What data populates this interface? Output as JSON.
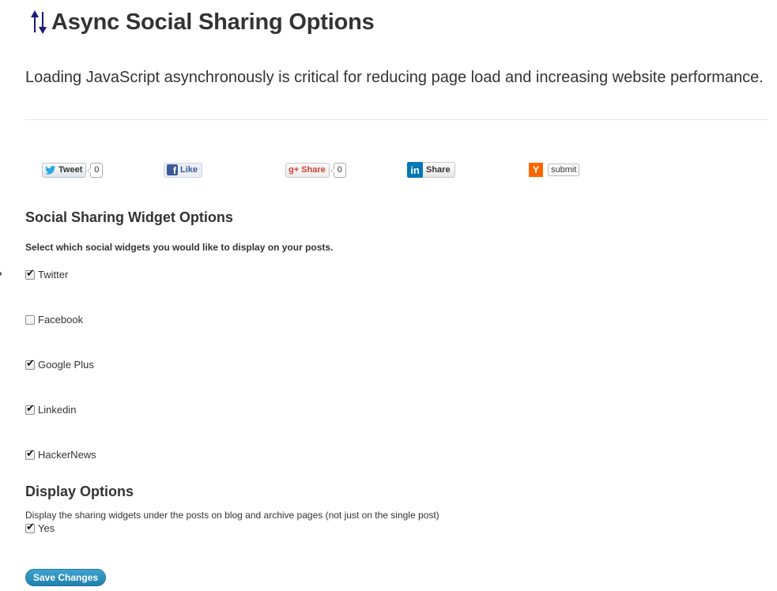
{
  "page": {
    "title": "Async Social Sharing Options",
    "intro": "Loading JavaScript asynchronously is critical for reducing page load and increasing website performance.",
    "icon": "up-down-arrows-icon"
  },
  "preview": {
    "twitter": {
      "label": "Tweet",
      "count": "0",
      "icon": "twitter-bird-icon",
      "color": "#2aa9e0"
    },
    "facebook": {
      "label": "Like",
      "icon": "facebook-f-icon",
      "color": "#3b5998"
    },
    "googleplus": {
      "label": "Share",
      "count": "0",
      "badge": "g+",
      "color": "#d23f31"
    },
    "linkedin": {
      "label": "Share",
      "badge": "in",
      "color": "#0077b5"
    },
    "hackernews": {
      "badge": "Y",
      "label": "submit",
      "color": "#ff6600"
    }
  },
  "widget_options": {
    "heading": "Social Sharing Widget Options",
    "description": "Select which social widgets you would like to display on your posts.",
    "items": [
      {
        "label": "Twitter",
        "checked": true
      },
      {
        "label": "Facebook",
        "checked": false
      },
      {
        "label": "Google Plus",
        "checked": true
      },
      {
        "label": "Linkedin",
        "checked": true
      },
      {
        "label": "HackerNews",
        "checked": true
      }
    ]
  },
  "display_options": {
    "heading": "Display Options",
    "description": "Display the sharing widgets under the posts on blog and archive pages (not just on the single post)",
    "yes_label": "Yes",
    "yes_checked": true
  },
  "actions": {
    "save_label": "Save Changes",
    "accent": "#2b8fc0"
  }
}
